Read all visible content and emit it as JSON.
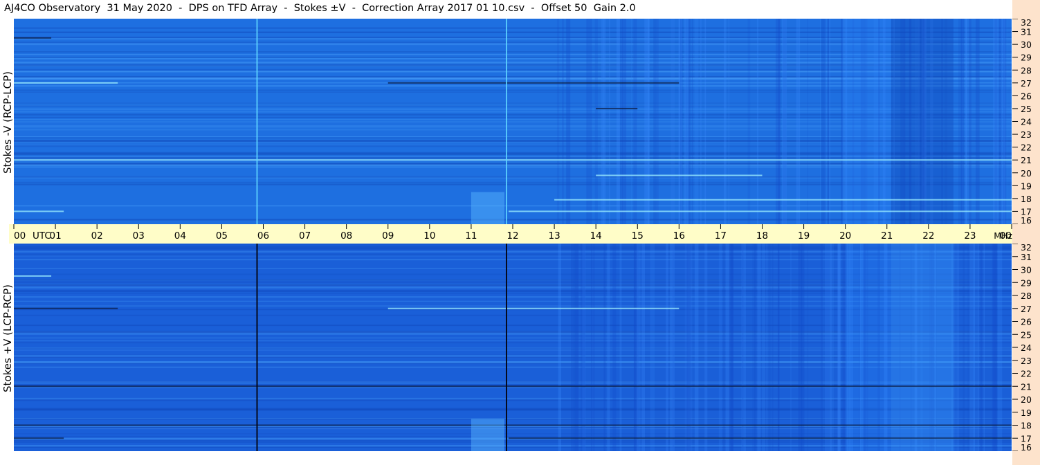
{
  "title": "AJ4CO Observatory  31 May 2020  -  DPS on TFD Array  -  Stokes ±V  -  Correction Array 2017 01 10.csv  -  Offset 50  Gain 2.0",
  "colors": {
    "background_top": "#1e6fe0",
    "background_bottom": "#1a5fd8",
    "time_axis_bg": "#fffdc8",
    "freq_axis_bg": "#fde3cc",
    "bright_line": "#9ff0ff",
    "dark_line": "#0a1a40"
  },
  "chart_data": [
    {
      "type": "heatmap",
      "panel": "top",
      "ylabel": "Stokes -V (RCP-LCP)",
      "y_unit": "MHz",
      "y_ticks": [
        "16",
        "17",
        "18",
        "19",
        "20",
        "21",
        "22",
        "23",
        "24",
        "25",
        "26",
        "27",
        "28",
        "29",
        "30",
        "31",
        "32"
      ],
      "ylim": [
        16,
        32
      ],
      "x_ticks": [
        "00",
        "01",
        "02",
        "03",
        "04",
        "05",
        "06",
        "07",
        "08",
        "09",
        "10",
        "11",
        "12",
        "13",
        "14",
        "15",
        "16",
        "17",
        "18",
        "19",
        "20",
        "21",
        "22",
        "23",
        "00"
      ],
      "x_unit_label": "UTC",
      "xlim": [
        0,
        24
      ],
      "vertical_lines": [
        {
          "time_utc": 5.85,
          "style": "bright"
        },
        {
          "time_utc": 11.85,
          "style": "bright"
        }
      ],
      "horizontal_features": [
        {
          "freq_mhz": 17.0,
          "t_start": 0.0,
          "t_end": 1.2,
          "style": "bright"
        },
        {
          "freq_mhz": 17.0,
          "t_start": 11.9,
          "t_end": 24.0,
          "style": "bright"
        },
        {
          "freq_mhz": 21.0,
          "t_start": 0.0,
          "t_end": 24.0,
          "style": "bright"
        },
        {
          "freq_mhz": 27.0,
          "t_start": 0.0,
          "t_end": 2.5,
          "style": "bright"
        },
        {
          "freq_mhz": 27.0,
          "t_start": 9.0,
          "t_end": 16.0,
          "style": "dark"
        },
        {
          "freq_mhz": 30.5,
          "t_start": 0.0,
          "t_end": 0.9,
          "style": "dark"
        },
        {
          "freq_mhz": 19.8,
          "t_start": 14.0,
          "t_end": 18.0,
          "style": "bright"
        },
        {
          "freq_mhz": 17.9,
          "t_start": 13.0,
          "t_end": 24.0,
          "style": "bright"
        },
        {
          "freq_mhz": 25.0,
          "t_start": 14.0,
          "t_end": 15.0,
          "style": "dark"
        }
      ]
    },
    {
      "type": "heatmap",
      "panel": "bottom",
      "ylabel": "Stokes +V (LCP-RCP)",
      "y_unit": "MHz",
      "y_ticks": [
        "16",
        "17",
        "18",
        "19",
        "20",
        "21",
        "22",
        "23",
        "24",
        "25",
        "26",
        "27",
        "28",
        "29",
        "30",
        "31",
        "32"
      ],
      "ylim": [
        16,
        32
      ],
      "xlim": [
        0,
        24
      ],
      "vertical_lines": [
        {
          "time_utc": 5.85,
          "style": "dark"
        },
        {
          "time_utc": 11.85,
          "style": "dark"
        }
      ],
      "horizontal_features": [
        {
          "freq_mhz": 17.0,
          "t_start": 0.0,
          "t_end": 1.2,
          "style": "dark"
        },
        {
          "freq_mhz": 17.0,
          "t_start": 11.9,
          "t_end": 24.0,
          "style": "dark"
        },
        {
          "freq_mhz": 21.0,
          "t_start": 0.0,
          "t_end": 24.0,
          "style": "dark"
        },
        {
          "freq_mhz": 27.0,
          "t_start": 0.0,
          "t_end": 2.5,
          "style": "dark"
        },
        {
          "freq_mhz": 27.0,
          "t_start": 9.0,
          "t_end": 16.0,
          "style": "bright"
        },
        {
          "freq_mhz": 29.5,
          "t_start": 0.0,
          "t_end": 0.9,
          "style": "bright"
        },
        {
          "freq_mhz": 18.0,
          "t_start": 0.0,
          "t_end": 24.0,
          "style": "dark"
        }
      ]
    }
  ]
}
